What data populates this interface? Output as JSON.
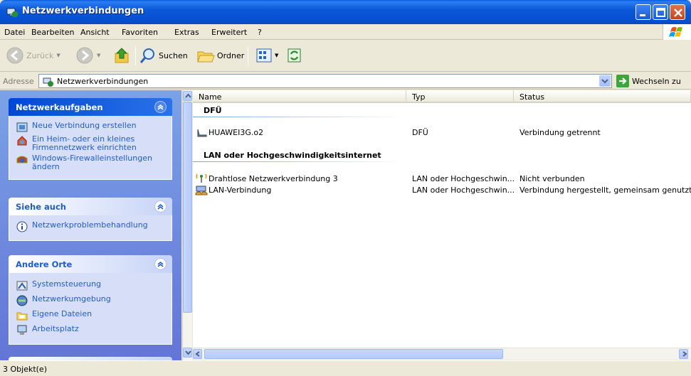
{
  "window": {
    "title": "Netzwerkverbindungen",
    "accent": "#0a58d8"
  },
  "menu": [
    "Datei",
    "Bearbeiten",
    "Ansicht",
    "Favoriten",
    "Extras",
    "Erweitert",
    "?"
  ],
  "toolbar": {
    "back": "Zurück",
    "search": "Suchen",
    "folders": "Ordner"
  },
  "address": {
    "label": "Adresse",
    "value": "Netzwerkverbindungen",
    "go": "Wechseln zu"
  },
  "taskpane": {
    "network_tasks": {
      "title": "Netzwerkaufgaben",
      "items": [
        {
          "label": "Neue Verbindung erstellen",
          "icon": "new-connection-icon"
        },
        {
          "label": "Ein Heim- oder ein kleines Firmennetzwerk einrichten",
          "icon": "home-network-icon"
        },
        {
          "label": "Windows-Firewalleinstellungen ändern",
          "icon": "firewall-icon"
        }
      ]
    },
    "see_also": {
      "title": "Siehe auch",
      "items": [
        {
          "label": "Netzwerkproblembehandlung",
          "icon": "info-icon"
        }
      ]
    },
    "other_places": {
      "title": "Andere Orte",
      "items": [
        {
          "label": "Systemsteuerung",
          "icon": "control-panel-icon"
        },
        {
          "label": "Netzwerkumgebung",
          "icon": "network-places-icon"
        },
        {
          "label": "Eigene Dateien",
          "icon": "my-documents-icon"
        },
        {
          "label": "Arbeitsplatz",
          "icon": "my-computer-icon"
        }
      ]
    }
  },
  "list": {
    "columns": [
      "Name",
      "Typ",
      "Status"
    ],
    "groups": [
      {
        "title": "DFÜ",
        "rows": [
          {
            "name": "HUAWEI3G.o2",
            "type": "DFÜ",
            "status": "Verbindung getrennt",
            "icon": "dialup-icon"
          }
        ]
      },
      {
        "title": "LAN oder Hochgeschwindigkeitsinternet",
        "rows": [
          {
            "name": "Drahtlose Netzwerkverbindung 3",
            "type": "LAN oder Hochgeschwin...",
            "status": "Nicht verbunden",
            "icon": "wireless-icon"
          },
          {
            "name": "LAN-Verbindung",
            "type": "LAN oder Hochgeschwin...",
            "status": "Verbindung hergestellt, gemeinsam genutzt",
            "icon": "lan-shared-icon"
          }
        ]
      }
    ]
  },
  "status": {
    "text": "3 Objekt(e)"
  }
}
